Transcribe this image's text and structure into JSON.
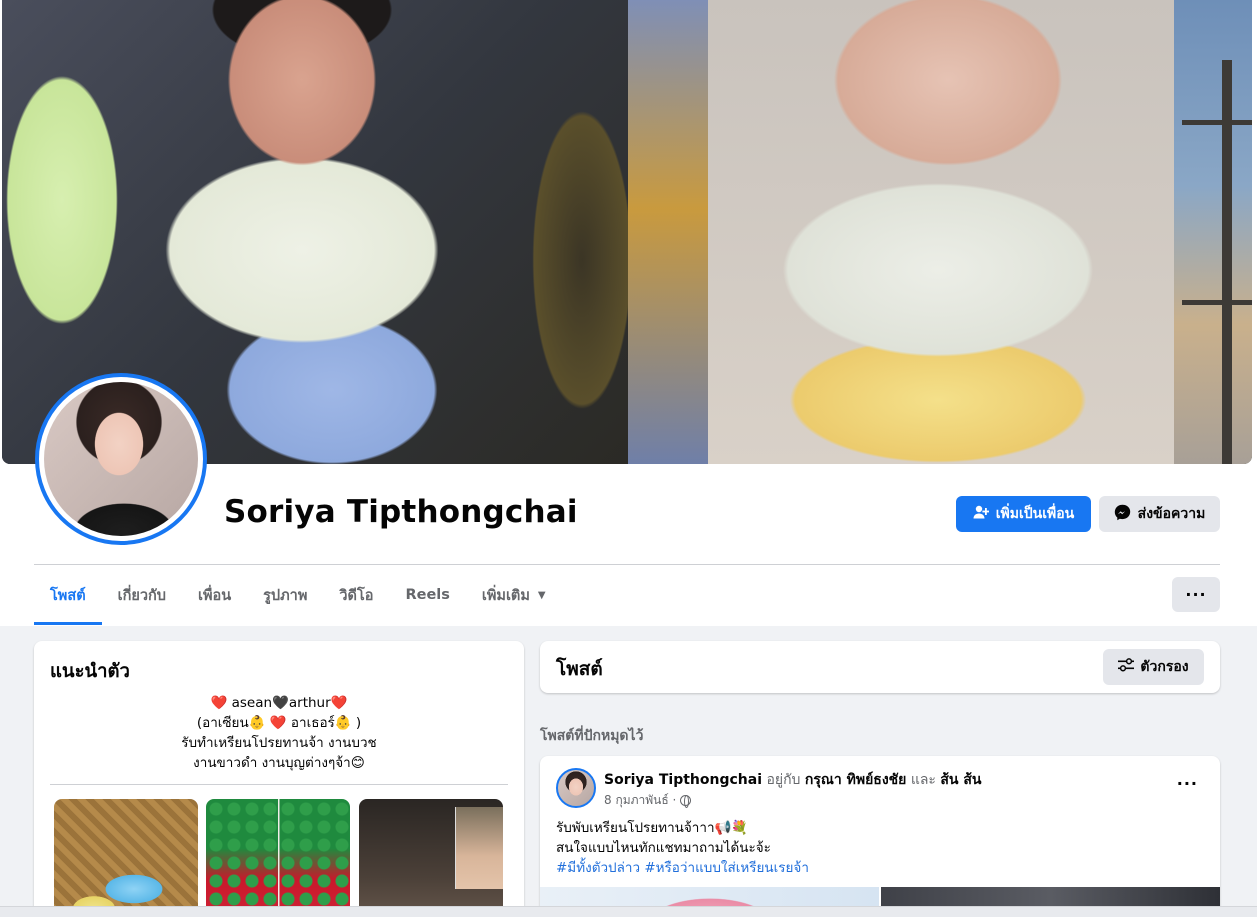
{
  "profile": {
    "name": "Soriya Tipthongchai"
  },
  "actions": {
    "add_friend_label": "เพิ่มเป็นเพื่อน",
    "message_label": "ส่งข้อความ"
  },
  "tabs": [
    {
      "label": "โพสต์",
      "active": true
    },
    {
      "label": "เกี่ยวกับ"
    },
    {
      "label": "เพื่อน"
    },
    {
      "label": "รูปภาพ"
    },
    {
      "label": "วิดีโอ"
    },
    {
      "label": "Reels"
    },
    {
      "label": "เพิ่มเติม"
    }
  ],
  "more_button": "···",
  "intro": {
    "title": "แนะนำตัว",
    "bio_lines": [
      "❤️ asean🖤arthur❤️",
      "(อาเซียน👶 ❤️ อาเธอร์👶 )",
      "รับทำเหรียนโปรยทานจ้า งานบวช",
      "งานขาวดำ งานบุญต่างๆจ้า😊"
    ]
  },
  "posts": {
    "title": "โพสต์",
    "filter_label": "ตัวกรอง",
    "pinned_label": "โพสต์ที่ปักหมุดไว้",
    "pinned_post": {
      "author": "Soriya Tipthongchai",
      "with_text": "อยู่กับ",
      "tagged_1": "กรุณา ทิพย์ธงชัย",
      "and_text": "และ",
      "tagged_2": "ส้น ส้น",
      "date": "8 กุมภาพันธ์ ·",
      "line_1": "รับพับเหรียนโปรยทานจ้าาา📢💐",
      "line_2": "สนใจแบบไหนทักแชทมาถามได้นะจ้ะ",
      "hashtags": "#มีทั้งตัวปล่าว #หรือว่าแบบใส่เหรียนเรยจ้า",
      "menu": "···"
    }
  },
  "colors": {
    "accent": "#1877f2",
    "background": "#f0f2f5",
    "secondary_button": "#e4e6eb",
    "muted_text": "#65676b"
  }
}
